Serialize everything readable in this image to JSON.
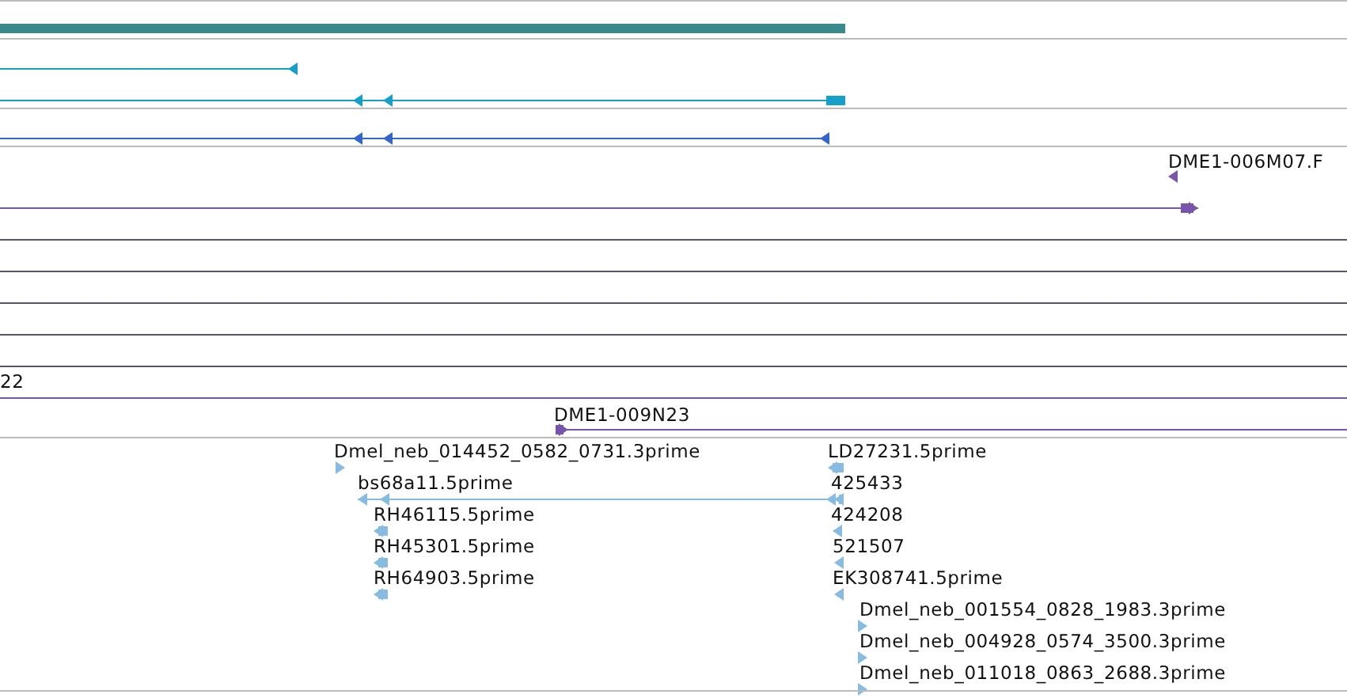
{
  "tracks": [
    {
      "kind": "bar"
    },
    {
      "kind": "transcript",
      "features": [
        {
          "reverse": true
        },
        {
          "reverse": true
        }
      ]
    },
    {
      "kind": "transcript",
      "features": [
        {
          "reverse": true
        }
      ]
    },
    {
      "kind": "clone",
      "features": [
        {
          "label": "DME1-006M07.F",
          "reverse": true
        },
        {
          "reverse": false
        },
        {
          "label": "22"
        },
        {
          "label": "DME1-009N23",
          "reverse": false
        }
      ]
    },
    {
      "kind": "read",
      "features": [
        {
          "label": "Dmel_neb_014452_0582_0731.3prime",
          "reverse": false
        },
        {
          "label": "bs68a11.5prime",
          "reverse": true
        },
        {
          "label": "RH46115.5prime",
          "reverse": true
        },
        {
          "label": "RH45301.5prime",
          "reverse": true
        },
        {
          "label": "RH64903.5prime",
          "reverse": true
        },
        {
          "label": "LD27231.5prime",
          "reverse": true
        },
        {
          "label": "425433",
          "reverse": true
        },
        {
          "label": "424208",
          "reverse": true
        },
        {
          "label": "521507",
          "reverse": true
        },
        {
          "label": "EK308741.5prime",
          "reverse": true
        },
        {
          "label": "Dmel_neb_001554_0828_1983.3prime",
          "reverse": false
        },
        {
          "label": "Dmel_neb_004928_0574_3500.3prime",
          "reverse": false
        },
        {
          "label": "Dmel_neb_011018_0863_2688.3prime",
          "reverse": false
        }
      ]
    }
  ]
}
